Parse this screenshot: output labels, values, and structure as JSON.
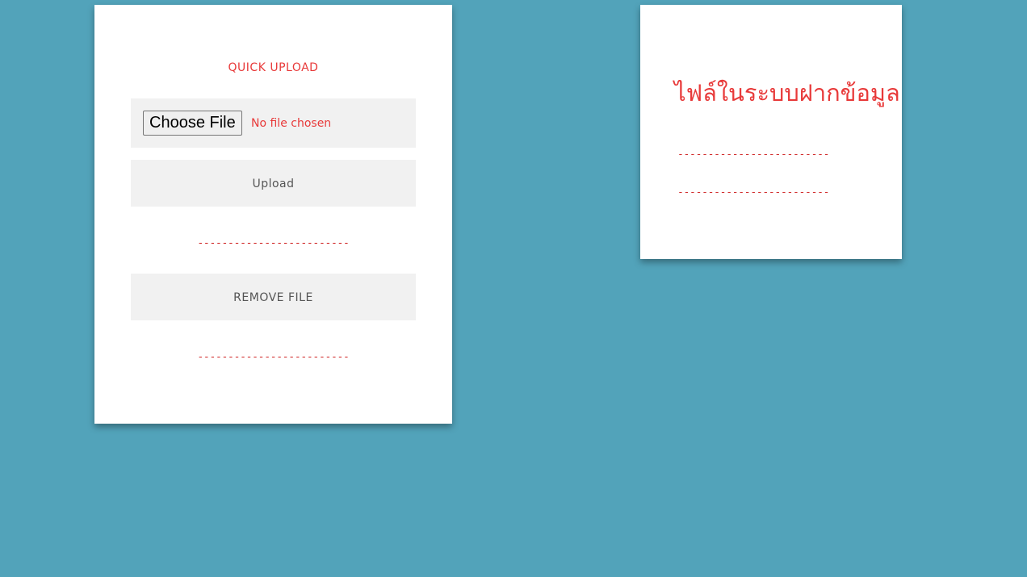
{
  "upload_card": {
    "title": "QUICK UPLOAD",
    "choose_file_label": "Choose File",
    "file_status": "No file chosen",
    "upload_label": "Upload",
    "upload_message": "-------------------------",
    "remove_label": "REMOVE FILE",
    "remove_message": "-------------------------"
  },
  "files_card": {
    "title": "ไฟล์ในระบบฝากข้อมูล",
    "lines": [
      "-------------------------",
      "-------------------------"
    ]
  },
  "colors": {
    "background": "#52a3ba",
    "accent": "#e83a3a",
    "panel": "#f1f1f1"
  }
}
